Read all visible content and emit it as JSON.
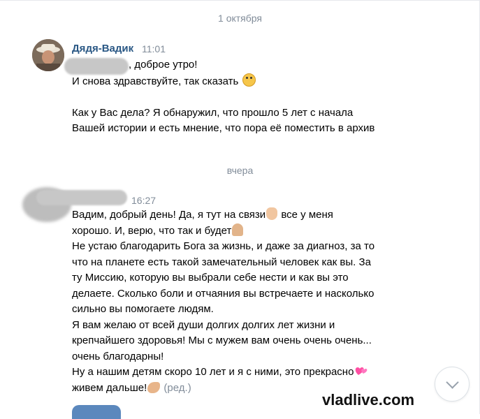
{
  "chat": {
    "date_1": "1 октября",
    "date_2": "вчера"
  },
  "messages": [
    {
      "author": "Дядя-Вадик",
      "time": "11:01",
      "lines": [
        ", доброе утро!",
        "И снова здравствуйте, так сказать",
        "",
        "Как у Вас дела? Я обнаружил, что прошло 5 лет с начала",
        "Вашей истории и есть мнение, что пора её поместить в архив"
      ],
      "emoji": "face-with-halo-icon"
    },
    {
      "author": "",
      "time": "16:27",
      "lines": [
        "Вадим, добрый день! Да, я тут на связи",
        " все у меня",
        "хорошо. И, верю, что так и будет",
        "Не устаю благодарить Бога за жизнь, и даже за диагноз, за то",
        "что на планете есть такой замечательный человек как вы. За",
        "ту Миссию, которую вы выбрали себе нести и как вы это",
        "делаете. Сколько боли и отчаяния вы встречаете и насколько",
        "сильно вы помогаете людям.",
        "Я вам желаю от всей души долгих долгих лет жизни и",
        "крепчайшего здоровья! Мы с мужем вам очень очень очень...",
        "очень благодарны!",
        "Ну а нашим детям скоро 10 лет и я с ними, это прекрасно",
        "живем дальше!",
        "(ред.)"
      ],
      "emojis": [
        "waving-hand-icon",
        "folded-hands-icon",
        "hearts-icon",
        "flexed-biceps-icon"
      ]
    }
  ],
  "watermark": "vladlive.com",
  "controls": {
    "scroll_down_icon": "chevron-down-icon"
  }
}
